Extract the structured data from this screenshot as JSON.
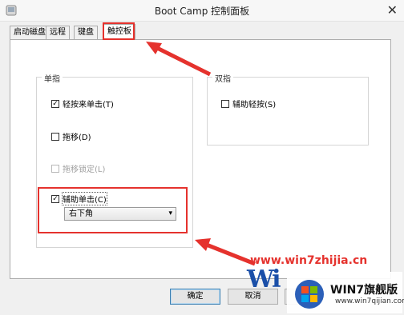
{
  "window": {
    "title": "Boot Camp 控制面板",
    "close": "✕"
  },
  "tabs": [
    {
      "label": "启动磁盘"
    },
    {
      "label": "远程"
    },
    {
      "label": "键盘"
    },
    {
      "label": "触控板",
      "active": true
    }
  ],
  "single_finger": {
    "title": "单指",
    "tap_to_click": {
      "label": "轻按来单击(T)",
      "checked": true
    },
    "dragging": {
      "label": "拖移(D)",
      "checked": false
    },
    "drag_lock": {
      "label": "拖移锁定(L)",
      "checked": false,
      "disabled": true
    },
    "secondary_click": {
      "label": "辅助单击(C)",
      "checked": true
    },
    "secondary_click_option": {
      "value": "右下角"
    }
  },
  "two_finger": {
    "title": "双指",
    "secondary_tap": {
      "label": "辅助轻按(S)",
      "checked": false
    }
  },
  "buttons": {
    "ok": "确定",
    "cancel": "取消"
  },
  "watermark": {
    "url": "www.win7zhijia.cn",
    "brand": "WIN7旗舰版",
    "sub": "www.win7qijian.com",
    "logo_text": "Wi"
  },
  "colors": {
    "highlight": "#e5322d",
    "arrow": "#e5322d"
  }
}
